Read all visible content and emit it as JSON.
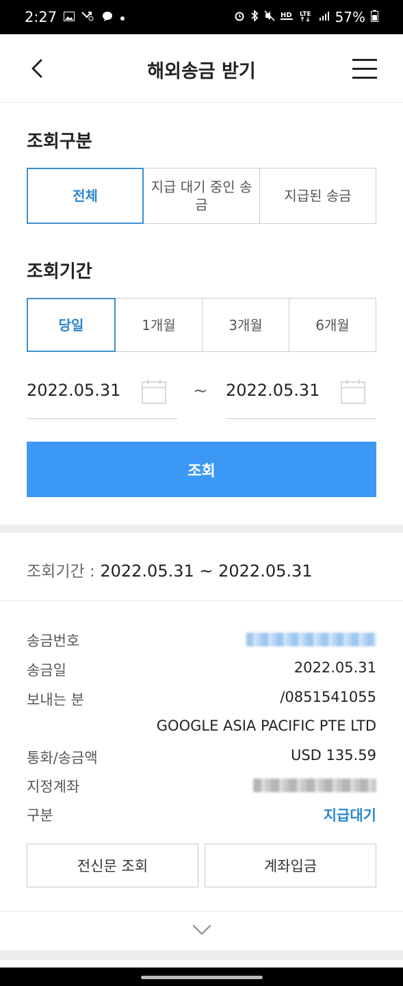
{
  "status_bar": {
    "time": "2:27",
    "left_icons": [
      "image-icon",
      "missed-call-icon",
      "messenger-icon",
      "dot-icon"
    ],
    "right_icons": [
      "alarm-icon",
      "bluetooth-icon",
      "mute-icon",
      "hd-voice-icon",
      "lte-icon",
      "signal-icon"
    ],
    "battery": "57%"
  },
  "header": {
    "title": "해외송금 받기",
    "back_icon": "chevron-left-icon",
    "menu_icon": "hamburger-menu-icon"
  },
  "inquiry_type": {
    "label": "조회구분",
    "options": [
      "전체",
      "지급 대기 중인 송금",
      "지급된 송금"
    ],
    "selected": "전체"
  },
  "inquiry_period": {
    "label": "조회기간",
    "options": [
      "당일",
      "1개월",
      "3개월",
      "6개월"
    ],
    "selected": "당일",
    "start_date": "2022.05.31",
    "end_date": "2022.05.31",
    "separator": "~",
    "calendar_icon": "calendar-icon"
  },
  "search_button": "조회",
  "result": {
    "period_label": "조회기간 :",
    "period_value": "2022.05.31 ~ 2022.05.31",
    "rows": {
      "remit_no_label": "송금번호",
      "remit_date_label": "송금일",
      "remit_date_value": "2022.05.31",
      "sender_label": "보내는 분",
      "sender_account": "/0851541055",
      "sender_name": "GOOGLE ASIA PACIFIC PTE LTD",
      "currency_label": "통화/송금액",
      "currency_value": "USD 135.59",
      "account_label": "지정계좌",
      "status_label": "구분",
      "status_value": "지급대기"
    },
    "buttons": {
      "telegram": "전신문 조회",
      "deposit": "계좌입금"
    },
    "expand_icon": "chevron-down-icon"
  },
  "colors": {
    "accent": "#3b99f5",
    "selected_border": "#3b8fd0",
    "selected_text": "#2a86cf",
    "status_text": "#2a86cf"
  }
}
